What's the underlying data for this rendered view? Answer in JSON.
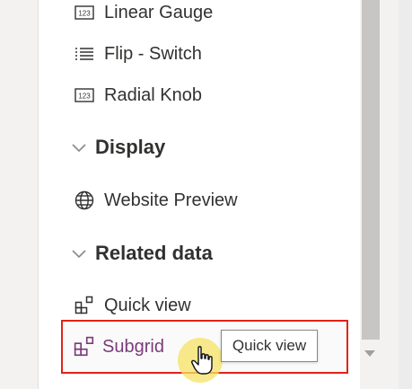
{
  "items": {
    "linear_gauge": "Linear Gauge",
    "flip_switch": "Flip - Switch",
    "radial_knob": "Radial Knob",
    "website_preview": "Website Preview",
    "quick_view": "Quick view",
    "subgrid": "Subgrid"
  },
  "sections": {
    "display": "Display",
    "related_data": "Related data"
  },
  "tooltip": "Quick view",
  "icons": {
    "numeric": "numeric-123-icon",
    "list": "list-icon",
    "globe": "globe-icon",
    "grid": "grid-icon",
    "chevron": "chevron-down-icon",
    "cursor": "hand-pointer-icon"
  },
  "colors": {
    "highlight_border": "#e2231a",
    "subgrid_text": "#7a3b7a",
    "cursor_halo": "#f5e264"
  }
}
